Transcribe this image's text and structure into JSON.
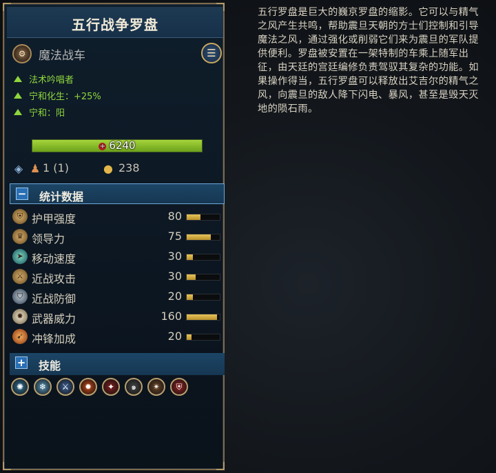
{
  "panel": {
    "title": "五行战争罗盘",
    "unit_type": "魔法战车",
    "unit_icon": "chariot-icon",
    "menu_icon": "menu-list-icon"
  },
  "traits": [
    {
      "label": "法术吟唱者"
    },
    {
      "label": "宁和化生：+25%"
    },
    {
      "label": "宁和：阳"
    }
  ],
  "health": {
    "value": "6240",
    "fraction": 1.0,
    "color": "#8fc32a"
  },
  "meta": {
    "rank": "1 (1)",
    "upkeep": "238"
  },
  "stats_section": {
    "label": "统计数据",
    "toggle": "−"
  },
  "stats": [
    {
      "label": "护甲强度",
      "value": "80",
      "fraction": 0.42,
      "icon": "armor-icon"
    },
    {
      "label": "领导力",
      "value": "75",
      "fraction": 0.72,
      "icon": "leadership-icon"
    },
    {
      "label": "移动速度",
      "value": "30",
      "fraction": 0.18,
      "icon": "speed-icon"
    },
    {
      "label": "近战攻击",
      "value": "30",
      "fraction": 0.28,
      "icon": "melee-attack-icon"
    },
    {
      "label": "近战防御",
      "value": "20",
      "fraction": 0.18,
      "icon": "melee-defence-icon"
    },
    {
      "label": "武器威力",
      "value": "160",
      "fraction": 0.92,
      "icon": "weapon-strength-icon"
    },
    {
      "label": "冲锋加成",
      "value": "20",
      "fraction": 0.15,
      "icon": "charge-bonus-icon"
    }
  ],
  "skills_section": {
    "label": "技能",
    "toggle": "+"
  },
  "skills": [
    {
      "icon": "ward-icon",
      "color": "#2b5f7d"
    },
    {
      "icon": "frost-icon",
      "color": "#4a7a96"
    },
    {
      "icon": "blade-icon",
      "color": "#34507a"
    },
    {
      "icon": "fire-icon",
      "color": "#a23c14"
    },
    {
      "icon": "blood-icon",
      "color": "#6a1c1c"
    },
    {
      "icon": "spiral-icon",
      "color": "#3a3a3a"
    },
    {
      "icon": "explosion-icon",
      "color": "#5a3a22"
    },
    {
      "icon": "shield-emblem-icon",
      "color": "#7a1e1e"
    }
  ],
  "description": "五行罗盘是巨大的巍京罗盘的缩影。它可以与精气之风产生共鸣，帮助震旦天朝的方士们控制和引导魔法之风，通过强化或削弱它们来为震旦的军队提供便利。罗盘被安置在一架特制的车乘上随军出征，由天廷的宫廷编修负责驾驭其复杂的功能。如果操作得当，五行罗盘可以释放出艾吉尔的精气之风，向震旦的敌人降下闪电、暴风，甚至是毁天灭地的陨石雨。"
}
